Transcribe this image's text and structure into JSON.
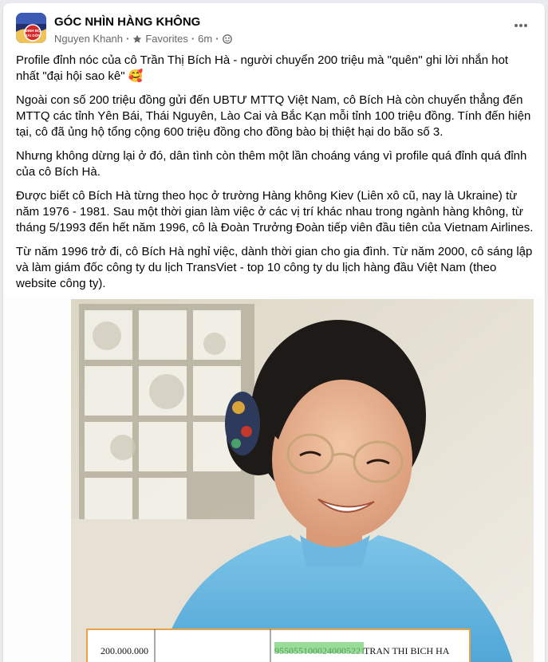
{
  "post": {
    "page_name": "GÓC NHÌN HÀNG KHÔNG",
    "author": "Nguyen Khanh",
    "audience": "Favorites",
    "time": "6m",
    "avatar_label": "SÀI GÒN",
    "paragraphs": [
      "Profile đỉnh nóc của cô Trần Thị Bích Hà - người chuyển 200 triệu mà \"quên\" ghi lời nhắn hot nhất \"đại hội sao kê\" 🥰",
      "Ngoài con số 200 triệu đồng gửi đến UBTƯ MTTQ Việt Nam, cô Bích Hà còn chuyển thẳng đến MTTQ các tỉnh Yên Bái, Thái Nguyên, Lào Cai và Bắc Kạn mỗi tỉnh 100 triệu đồng. Tính đến hiện tại, cô đã ủng hộ tổng cộng 600 triệu đồng cho đồng bào bị thiệt hại do bão số 3.",
      "Nhưng không dừng lại ở đó, dân tình còn thêm một lần choáng váng vì profile quá đỉnh quá đỉnh của cô Bích Hà.",
      "Được biết cô Bích Hà từng theo học ở trường Hàng không Kiev (Liên xô cũ, nay là Ukraine) từ năm 1976 - 1981. Sau một thời gian làm việc ở các vị trí khác nhau trong ngành hàng không, từ tháng 5/1993 đến hết năm 1996, cô là Đoàn Trưởng Đoàn tiếp viên đầu tiên của Vietnam Airlines.",
      "Từ năm 1996 trở đi, cô Bích Hà nghỉ việc, dành thời gian cho gia đình. Từ năm 2000, cô sáng lập và làm giám đốc công ty du lịch TransViet - top 10 công ty du lịch hàng đầu Việt Nam (theo website công ty)."
    ],
    "receipt": {
      "amount": "200.000.000",
      "account": "9550551000240005221",
      "name": "TRAN THI BICH HA"
    }
  }
}
